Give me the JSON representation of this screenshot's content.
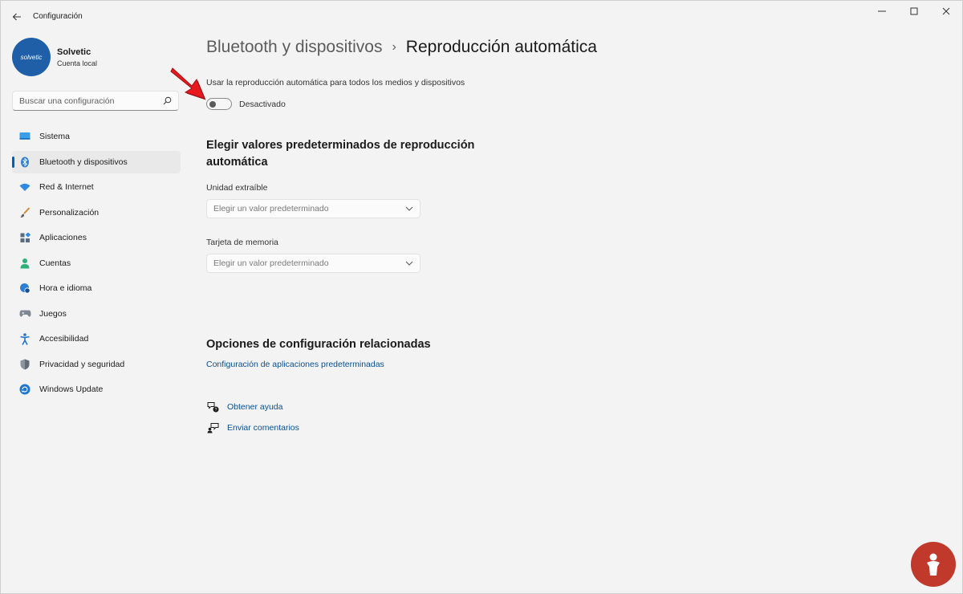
{
  "window": {
    "title": "Configuración"
  },
  "profile": {
    "avatar_text": "solvetic",
    "name": "Solvetic",
    "account_type": "Cuenta local"
  },
  "search": {
    "placeholder": "Buscar una configuración"
  },
  "sidebar": {
    "items": [
      {
        "label": "Sistema",
        "icon": "monitor-icon"
      },
      {
        "label": "Bluetooth y dispositivos",
        "icon": "bluetooth-icon",
        "active": true
      },
      {
        "label": "Red & Internet",
        "icon": "wifi-icon"
      },
      {
        "label": "Personalización",
        "icon": "brush-icon"
      },
      {
        "label": "Aplicaciones",
        "icon": "apps-icon"
      },
      {
        "label": "Cuentas",
        "icon": "person-icon"
      },
      {
        "label": "Hora e idioma",
        "icon": "globe-clock-icon"
      },
      {
        "label": "Juegos",
        "icon": "gamepad-icon"
      },
      {
        "label": "Accesibilidad",
        "icon": "accessibility-icon"
      },
      {
        "label": "Privacidad y seguridad",
        "icon": "shield-icon"
      },
      {
        "label": "Windows Update",
        "icon": "update-icon"
      }
    ]
  },
  "breadcrumb": {
    "parent": "Bluetooth y dispositivos",
    "separator": "›",
    "current": "Reproducción automática"
  },
  "autoplay": {
    "label": "Usar la reproducción automática para todos los medios y dispositivos",
    "state_label": "Desactivado",
    "enabled": false
  },
  "defaults": {
    "title": "Elegir valores predeterminados de reproducción automática",
    "removable_label": "Unidad extraíble",
    "removable_value": "Elegir un valor predeterminado",
    "memory_label": "Tarjeta de memoria",
    "memory_value": "Elegir un valor predeterminado"
  },
  "related": {
    "title": "Opciones de configuración relacionadas",
    "link": "Configuración de aplicaciones predeterminadas"
  },
  "help": {
    "get_help": "Obtener ayuda",
    "feedback": "Enviar comentarios"
  },
  "colors": {
    "accent": "#005fb8",
    "link": "#0a4f91",
    "background": "#f3f3f3",
    "annotation_arrow": "#e8191e"
  }
}
